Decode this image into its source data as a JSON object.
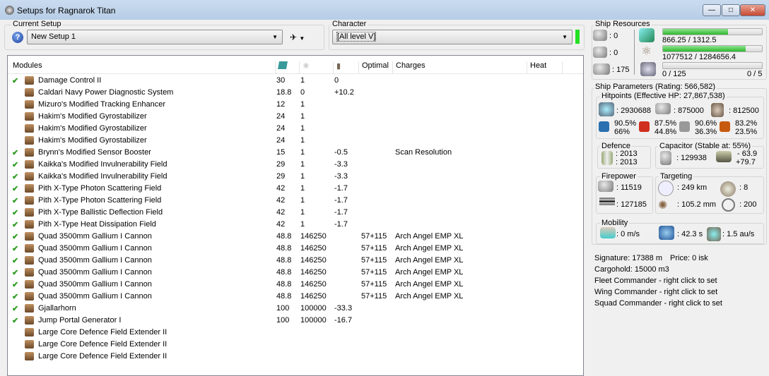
{
  "window": {
    "title": "Setups for Ragnarok Titan",
    "min": "—",
    "max": "□",
    "close": "✕"
  },
  "current_setup": {
    "label": "Current Setup",
    "value": "New Setup 1"
  },
  "character": {
    "label": "Character",
    "value": "[All level V]"
  },
  "columns": [
    "Modules",
    "",
    "",
    "",
    "Optimal",
    "Charges",
    "Heat"
  ],
  "modules": [
    {
      "c": true,
      "name": "Damage Control II",
      "a": "30",
      "b": "1",
      "d": "0",
      "opt": "",
      "ch": ""
    },
    {
      "c": false,
      "name": "Caldari Navy Power Diagnostic System",
      "a": "18.8",
      "b": "0",
      "d": "+10.2",
      "opt": "",
      "ch": ""
    },
    {
      "c": false,
      "name": "Mizuro's Modified Tracking Enhancer",
      "a": "12",
      "b": "1",
      "d": "",
      "opt": "",
      "ch": ""
    },
    {
      "c": false,
      "name": "Hakim's Modified Gyrostabilizer",
      "a": "24",
      "b": "1",
      "d": "",
      "opt": "",
      "ch": ""
    },
    {
      "c": false,
      "name": "Hakim's Modified Gyrostabilizer",
      "a": "24",
      "b": "1",
      "d": "",
      "opt": "",
      "ch": ""
    },
    {
      "c": false,
      "name": "Hakim's Modified Gyrostabilizer",
      "a": "24",
      "b": "1",
      "d": "",
      "opt": "",
      "ch": ""
    },
    {
      "c": true,
      "name": "Brynn's Modified Sensor Booster",
      "a": "15",
      "b": "1",
      "d": "-0.5",
      "opt": "",
      "ch": "Scan Resolution"
    },
    {
      "c": true,
      "name": "Kaikka's Modified Invulnerability Field",
      "a": "29",
      "b": "1",
      "d": "-3.3",
      "opt": "",
      "ch": ""
    },
    {
      "c": true,
      "name": "Kaikka's Modified Invulnerability Field",
      "a": "29",
      "b": "1",
      "d": "-3.3",
      "opt": "",
      "ch": ""
    },
    {
      "c": true,
      "name": "Pith X-Type Photon Scattering Field",
      "a": "42",
      "b": "1",
      "d": "-1.7",
      "opt": "",
      "ch": ""
    },
    {
      "c": true,
      "name": "Pith X-Type Photon Scattering Field",
      "a": "42",
      "b": "1",
      "d": "-1.7",
      "opt": "",
      "ch": ""
    },
    {
      "c": true,
      "name": "Pith X-Type Ballistic Deflection Field",
      "a": "42",
      "b": "1",
      "d": "-1.7",
      "opt": "",
      "ch": ""
    },
    {
      "c": true,
      "name": "Pith X-Type Heat Dissipation Field",
      "a": "42",
      "b": "1",
      "d": "-1.7",
      "opt": "",
      "ch": ""
    },
    {
      "c": true,
      "name": "Quad 3500mm Gallium I Cannon",
      "a": "48.8",
      "b": "146250",
      "d": "",
      "opt": "57+115",
      "ch": "Arch Angel EMP XL"
    },
    {
      "c": true,
      "name": "Quad 3500mm Gallium I Cannon",
      "a": "48.8",
      "b": "146250",
      "d": "",
      "opt": "57+115",
      "ch": "Arch Angel EMP XL"
    },
    {
      "c": true,
      "name": "Quad 3500mm Gallium I Cannon",
      "a": "48.8",
      "b": "146250",
      "d": "",
      "opt": "57+115",
      "ch": "Arch Angel EMP XL"
    },
    {
      "c": true,
      "name": "Quad 3500mm Gallium I Cannon",
      "a": "48.8",
      "b": "146250",
      "d": "",
      "opt": "57+115",
      "ch": "Arch Angel EMP XL"
    },
    {
      "c": true,
      "name": "Quad 3500mm Gallium I Cannon",
      "a": "48.8",
      "b": "146250",
      "d": "",
      "opt": "57+115",
      "ch": "Arch Angel EMP XL"
    },
    {
      "c": true,
      "name": "Quad 3500mm Gallium I Cannon",
      "a": "48.8",
      "b": "146250",
      "d": "",
      "opt": "57+115",
      "ch": "Arch Angel EMP XL"
    },
    {
      "c": true,
      "name": "Gjallarhorn",
      "a": "100",
      "b": "100000",
      "d": "-33.3",
      "opt": "",
      "ch": ""
    },
    {
      "c": true,
      "name": "Jump Portal Generator I",
      "a": "100",
      "b": "100000",
      "d": "-16.7",
      "opt": "",
      "ch": ""
    },
    {
      "c": false,
      "name": "Large Core Defence Field Extender II",
      "a": "",
      "b": "",
      "d": "",
      "opt": "",
      "ch": ""
    },
    {
      "c": false,
      "name": "Large Core Defence Field Extender II",
      "a": "",
      "b": "",
      "d": "",
      "opt": "",
      "ch": ""
    },
    {
      "c": false,
      "name": "Large Core Defence Field Extender II",
      "a": "",
      "b": "",
      "d": "",
      "opt": "",
      "ch": ""
    }
  ],
  "resources": {
    "label": "Ship Resources",
    "turrets": ": 0",
    "launchers": ": 0",
    "calibration": ": 175",
    "cpu": "866.25 / 1312.5",
    "cpu_fraction": 0.66,
    "power": "1077512 / 1284656.4",
    "power_fraction": 0.839,
    "drones": "0 / 125",
    "drone_count": "0 / 5",
    "drone_fraction": 0
  },
  "params": {
    "label": "Ship Parameters (Rating: 566,582)",
    "hp_label": "Hitpoints (Effective HP: 27,867,538)",
    "shield": ": 2930688",
    "armor": ": 875000",
    "hull": ": 812500",
    "res": [
      [
        "90.5%",
        "66%"
      ],
      [
        "87.5%",
        "44.8%"
      ],
      [
        "90.6%",
        "36.3%"
      ],
      [
        "83.2%",
        "23.5%"
      ]
    ],
    "defence_label": "Defence",
    "def1": ": 2013",
    "def2": ": 2013",
    "cap_label": "Capacitor (Stable at: 55%)",
    "cap": ": 129938",
    "cap_use": "- 63.9",
    "cap_regen": "+79.7",
    "fire_label": "Firepower",
    "fire1": ": 11519",
    "fire2": ": 127185",
    "target_label": "Targeting",
    "range": ": 249 km",
    "scanres": ": 105.2 mm",
    "maxtargets": ": 8",
    "sensor": ": 200",
    "mob_label": "Mobility",
    "speed": ": 0 m/s",
    "align": ": 42.3 s",
    "warp": ": 1.5 au/s",
    "signature": "Signature: 17388 m",
    "price": "Price: 0 isk",
    "cargo": "Cargohold: 15000 m3",
    "fleet": "Fleet Commander - right click to set",
    "wing": "Wing Commander - right click to set",
    "squad": "Squad Commander - right click to set"
  }
}
